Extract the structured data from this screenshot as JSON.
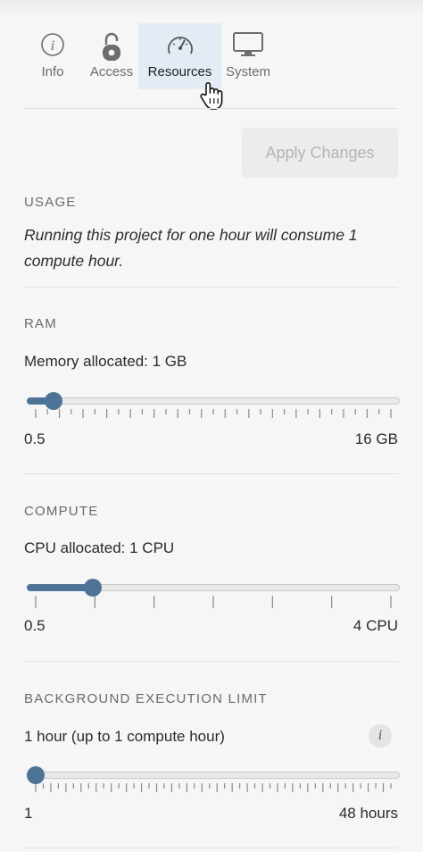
{
  "tabs": [
    {
      "label": "Info",
      "icon": "info-icon"
    },
    {
      "label": "Access",
      "icon": "lock-icon"
    },
    {
      "label": "Resources",
      "icon": "gauge-icon"
    },
    {
      "label": "System",
      "icon": "monitor-icon"
    }
  ],
  "active_tab": "Resources",
  "apply_label": "Apply Changes",
  "usage": {
    "title": "USAGE",
    "text": "Running this project for one hour will consume 1 compute hour."
  },
  "ram": {
    "title": "RAM",
    "label": "Memory allocated: 1 GB",
    "min_label": "0.5",
    "max_label": "16 GB",
    "fraction": 0.05
  },
  "compute": {
    "title": "COMPUTE",
    "label": "CPU allocated: 1 CPU",
    "min_label": "0.5",
    "max_label": "4 CPU",
    "fraction": 0.16
  },
  "background": {
    "title": "BACKGROUND EXECUTION LIMIT",
    "label": "1 hour (up to 1 compute hour)",
    "info_icon": "info-icon",
    "min_label": "1",
    "max_label": "48 hours",
    "fraction": 0.0
  },
  "colors": {
    "accent": "#4d7497",
    "active_tab_bg": "#e3ecf4"
  }
}
